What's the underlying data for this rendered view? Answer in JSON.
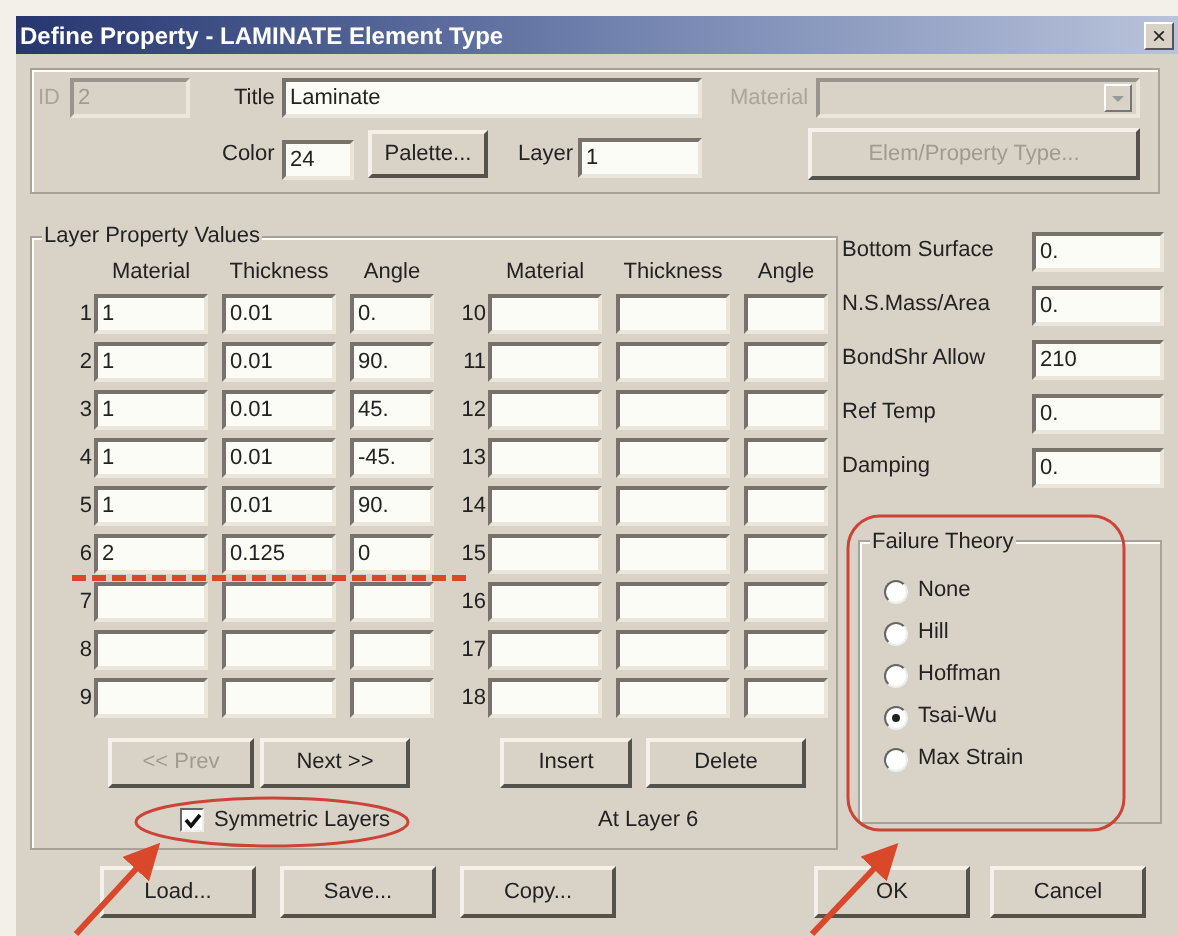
{
  "window": {
    "title": "Define Property - LAMINATE Element Type",
    "close": "×"
  },
  "header": {
    "id": {
      "label": "ID",
      "value": "2",
      "disabled": true
    },
    "title": {
      "label": "Title",
      "value": "Laminate"
    },
    "material": {
      "label": "Material",
      "disabled": true
    },
    "color": {
      "label": "Color",
      "value": "24"
    },
    "palette_button": "Palette...",
    "layer": {
      "label": "Layer",
      "value": "1"
    },
    "elem_type_button": {
      "label": "Elem/Property Type...",
      "disabled": true
    }
  },
  "layers": {
    "title": "Layer Property Values",
    "columns": [
      "Material",
      "Thickness",
      "Angle",
      "Material",
      "Thickness",
      "Angle"
    ],
    "rows": [
      {
        "number": "1",
        "material": "1",
        "thickness": "0.01",
        "angle": "0."
      },
      {
        "number": "2",
        "material": "1",
        "thickness": "0.01",
        "angle": "90."
      },
      {
        "number": "3",
        "material": "1",
        "thickness": "0.01",
        "angle": "45."
      },
      {
        "number": "4",
        "material": "1",
        "thickness": "0.01",
        "angle": "-45."
      },
      {
        "number": "5",
        "material": "1",
        "thickness": "0.01",
        "angle": "90."
      },
      {
        "number": "6",
        "material": "2",
        "thickness": "0.125",
        "angle": "0"
      },
      {
        "number": "7"
      },
      {
        "number": "8"
      },
      {
        "number": "9"
      },
      {
        "number": "10"
      },
      {
        "number": "11"
      },
      {
        "number": "12"
      },
      {
        "number": "13"
      },
      {
        "number": "14"
      },
      {
        "number": "15"
      },
      {
        "number": "16"
      },
      {
        "number": "17"
      },
      {
        "number": "18"
      }
    ],
    "buttons": [
      {
        "label": "<< Prev",
        "disabled": true
      },
      {
        "label": "Next >>",
        "disabled": false
      },
      {
        "label": "Insert",
        "disabled": false
      },
      {
        "label": "Delete",
        "disabled": false
      }
    ],
    "symmetric": {
      "label": "Symmetric Layers",
      "checked": true
    },
    "status": "At Layer 6"
  },
  "properties": [
    {
      "label": "Bottom Surface",
      "value": "0."
    },
    {
      "label": "N.S.Mass/Area",
      "value": "0."
    },
    {
      "label": "BondShr Allow",
      "value": "210"
    },
    {
      "label": "Ref Temp",
      "value": "0."
    },
    {
      "label": "Damping",
      "value": "0."
    }
  ],
  "failure_theory": {
    "title": "Failure Theory",
    "options": [
      {
        "label": "None",
        "selected": false
      },
      {
        "label": "Hill",
        "selected": false
      },
      {
        "label": "Hoffman",
        "selected": false
      },
      {
        "label": "Tsai-Wu",
        "selected": true
      },
      {
        "label": "Max Strain",
        "selected": false
      }
    ]
  },
  "footer_left": [
    "Load...",
    "Save...",
    "Copy..."
  ],
  "footer_right": [
    "OK",
    "Cancel"
  ]
}
